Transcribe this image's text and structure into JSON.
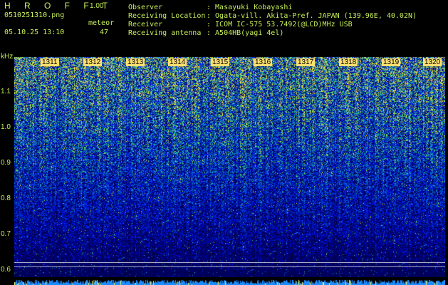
{
  "header": {
    "app_title": "H R O F F T",
    "version": "1.00",
    "filename": "0510251310.png",
    "mode_label": "meteor",
    "datetime": "05.10.25 13:10",
    "count": "47",
    "observer_label": "Observer",
    "observer_value": ": Masayuki Kobayashi",
    "location_label": "Receiving Location",
    "location_value": ": Ogata-vill. Akita-Pref. JAPAN (139.96E, 40.02N)",
    "receiver_label": "Receiver",
    "receiver_value": ": ICOM IC-575 53.7492(@LCD)MHz USB",
    "antenna_label": "Receiving antenna",
    "antenna_value": ": A504HB(yagi 4el)"
  },
  "y_axis": {
    "unit": "kHz",
    "ticks": [
      "1.1",
      "1.0",
      "0.9",
      "0.8",
      "0.7",
      "0.6"
    ]
  },
  "time_labels": [
    "1311",
    "1312",
    "1313",
    "1314",
    "1315",
    "1316",
    "1317",
    "1318",
    "1319",
    "1320"
  ],
  "colors": {
    "label_green": "#c8f05a",
    "marker_yellow": "#ffe070",
    "background": "#000000"
  }
}
